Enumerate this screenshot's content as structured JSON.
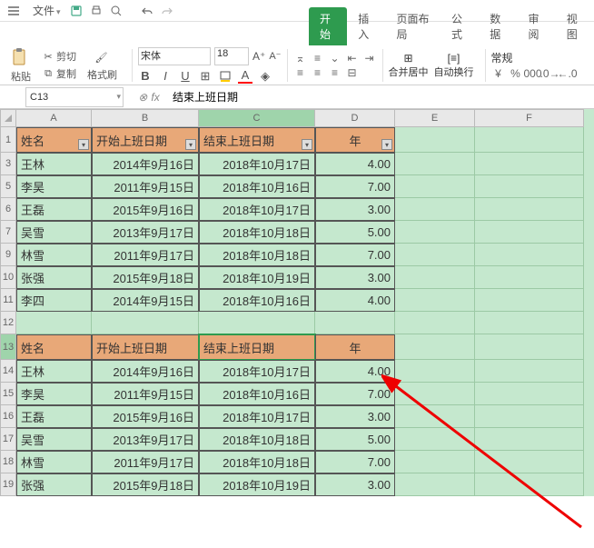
{
  "menubar": {
    "file_label": "文件"
  },
  "tabs": {
    "items": [
      "开始",
      "插入",
      "页面布局",
      "公式",
      "数据",
      "审阅",
      "视图"
    ],
    "active": 0
  },
  "ribbon": {
    "paste": "粘贴",
    "cut": "剪切",
    "copy": "复制",
    "format_painter": "格式刷",
    "font_name": "宋体",
    "font_size": "18",
    "merge": "合并居中",
    "wrap": "自动换行",
    "number_format": "常规"
  },
  "formula_bar": {
    "cell_ref": "C13",
    "formula": "结束上班日期"
  },
  "columns": [
    "",
    "A",
    "B",
    "C",
    "D",
    "E",
    "F"
  ],
  "rows": [
    {
      "n": 1,
      "type": "header",
      "cells": [
        "姓名",
        "开始上班日期",
        "结束上班日期",
        "年"
      ],
      "filter": true
    },
    {
      "n": 3,
      "type": "data",
      "cells": [
        "王林",
        "2014年9月16日",
        "2018年10月17日",
        "4.00"
      ]
    },
    {
      "n": 5,
      "type": "data",
      "cells": [
        "李昊",
        "2011年9月15日",
        "2018年10月16日",
        "7.00"
      ]
    },
    {
      "n": 6,
      "type": "data",
      "cells": [
        "王磊",
        "2015年9月16日",
        "2018年10月17日",
        "3.00"
      ]
    },
    {
      "n": 7,
      "type": "data",
      "cells": [
        "吴雪",
        "2013年9月17日",
        "2018年10月18日",
        "5.00"
      ]
    },
    {
      "n": 9,
      "type": "data",
      "cells": [
        "林雪",
        "2011年9月17日",
        "2018年10月18日",
        "7.00"
      ]
    },
    {
      "n": 10,
      "type": "data",
      "cells": [
        "张强",
        "2015年9月18日",
        "2018年10月19日",
        "3.00"
      ]
    },
    {
      "n": 11,
      "type": "data",
      "cells": [
        "李四",
        "2014年9月15日",
        "2018年10月16日",
        "4.00"
      ]
    },
    {
      "n": 12,
      "type": "empty"
    },
    {
      "n": 13,
      "type": "header",
      "cells": [
        "姓名",
        "开始上班日期",
        "结束上班日期",
        "年"
      ],
      "filter": false,
      "selected_col": 2
    },
    {
      "n": 14,
      "type": "data",
      "cells": [
        "王林",
        "2014年9月16日",
        "2018年10月17日",
        "4.00"
      ]
    },
    {
      "n": 15,
      "type": "data",
      "cells": [
        "李昊",
        "2011年9月15日",
        "2018年10月16日",
        "7.00"
      ]
    },
    {
      "n": 16,
      "type": "data",
      "cells": [
        "王磊",
        "2015年9月16日",
        "2018年10月17日",
        "3.00"
      ]
    },
    {
      "n": 17,
      "type": "data",
      "cells": [
        "吴雪",
        "2013年9月17日",
        "2018年10月18日",
        "5.00"
      ]
    },
    {
      "n": 18,
      "type": "data",
      "cells": [
        "林雪",
        "2011年9月17日",
        "2018年10月18日",
        "7.00"
      ]
    },
    {
      "n": 19,
      "type": "data",
      "cells": [
        "张强",
        "2015年9月18日",
        "2018年10月19日",
        "3.00"
      ]
    }
  ]
}
